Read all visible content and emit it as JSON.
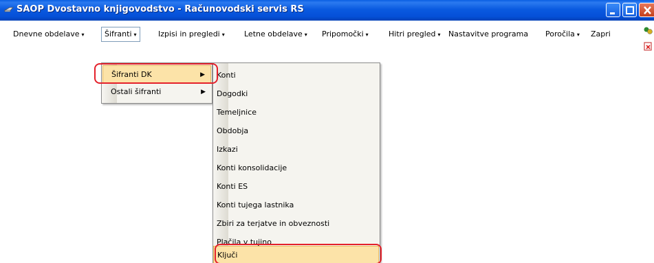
{
  "window": {
    "title": "SAOP Dvostavno knjigovodstvo  - Računovodski servis RS",
    "colors": {
      "titlebar": "#0a5ae0",
      "menu_highlight": "#fce3a8",
      "callout": "#e4202a"
    }
  },
  "menubar": {
    "items": [
      {
        "label": "Dnevne obdelave",
        "has_arrow": true
      },
      {
        "label": "Šifranti",
        "has_arrow": true
      },
      {
        "label": "Izpisi in pregledi",
        "has_arrow": true
      },
      {
        "label": "Letne obdelave",
        "has_arrow": true
      },
      {
        "label": "Pripomočki",
        "has_arrow": true
      },
      {
        "label": "Hitri pregled",
        "has_arrow": true
      },
      {
        "label": "Nastavitve programa",
        "has_arrow": false
      },
      {
        "label": "Poročila",
        "has_arrow": true
      },
      {
        "label": "Zapri",
        "has_arrow": false
      }
    ],
    "arrow_glyph": "▾"
  },
  "sifranti_menu": {
    "items": [
      {
        "label": "Šifranti DK",
        "highlighted": true
      },
      {
        "label": "Ostali šifranti",
        "highlighted": false
      }
    ],
    "submenu_arrow": "▶"
  },
  "sifranti_dk_menu": {
    "items": [
      "Konti",
      "Dogodki",
      "Temeljnice",
      "Obdobja",
      "Izkazi",
      "Konti konsolidacije",
      "Konti ES",
      "Konti tujega lastnika",
      "Zbiri za terjatve in obveznosti",
      "Plačila v tujino",
      "Ključi"
    ],
    "highlighted_item": "Ključi"
  }
}
